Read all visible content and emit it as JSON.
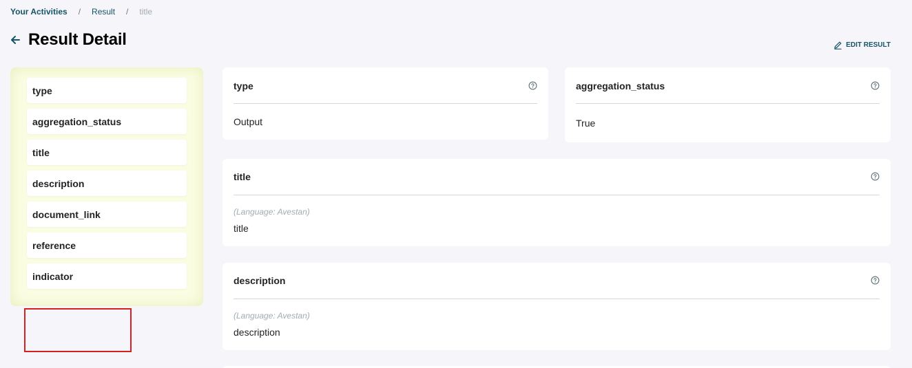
{
  "breadcrumb": {
    "root": "Your Activities",
    "separator": "/",
    "middle": "Result",
    "current": "title"
  },
  "header": {
    "title": "Result Detail",
    "edit_label": "EDIT RESULT"
  },
  "sidebar": {
    "items": [
      {
        "label": "type"
      },
      {
        "label": "aggregation_status"
      },
      {
        "label": "title"
      },
      {
        "label": "description"
      },
      {
        "label": "document_link"
      },
      {
        "label": "reference"
      },
      {
        "label": "indicator"
      }
    ]
  },
  "cards": {
    "type": {
      "title": "type",
      "value": "Output"
    },
    "aggregation_status": {
      "title": "aggregation_status",
      "value": "True"
    },
    "title": {
      "title": "title",
      "language": "(Language: Avestan)",
      "value": "title"
    },
    "description": {
      "title": "description",
      "language": "(Language: Avestan)",
      "value": "description"
    }
  },
  "colors": {
    "accent": "#155366",
    "sidebar_bg": "#fbfde3",
    "page_bg": "#f5f5fa",
    "highlight_border": "#d61f1f"
  },
  "icons": {
    "back": "arrow-left-icon",
    "edit": "pencil-icon",
    "help": "question-circle-icon"
  }
}
